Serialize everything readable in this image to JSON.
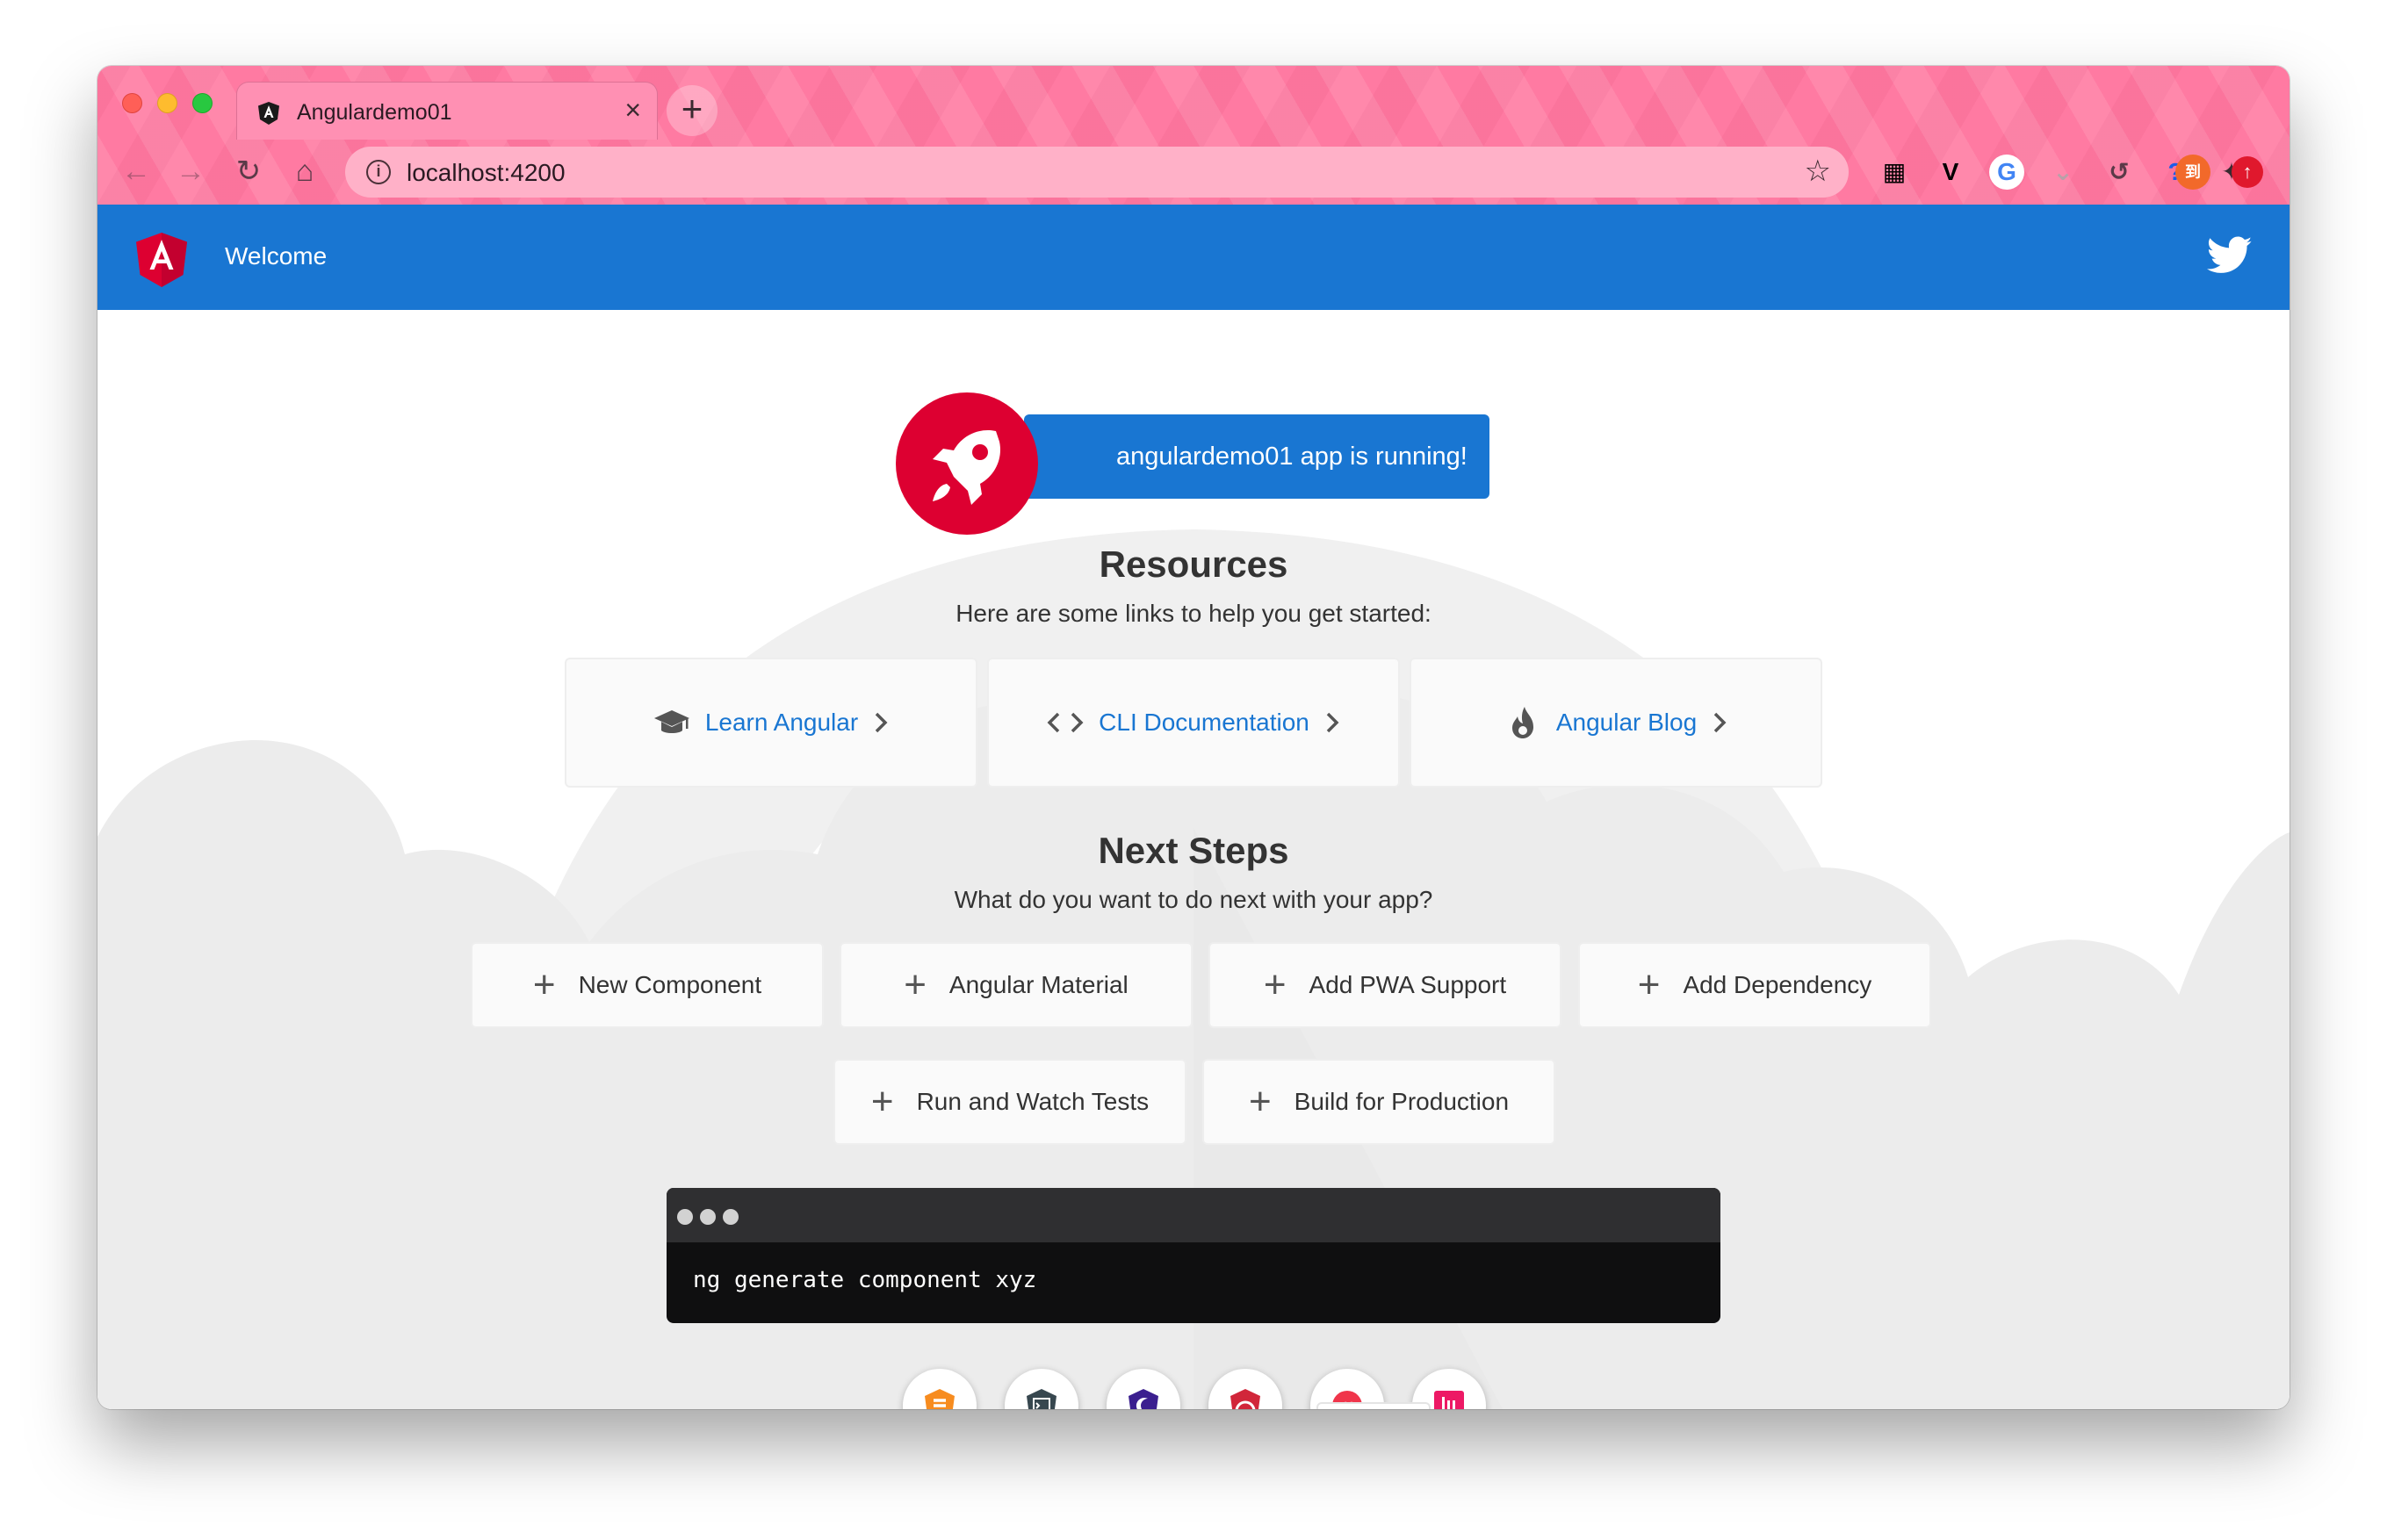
{
  "browser": {
    "tab": {
      "title": "Angulardemo01",
      "close_glyph": "×"
    },
    "new_tab_glyph": "+",
    "nav": {
      "back": "←",
      "forward": "→",
      "reload": "↻",
      "home": "⌂"
    },
    "url": "localhost:4200",
    "info_glyph": "i",
    "star_glyph": "☆",
    "extensions": [
      {
        "name": "qr-code-extension-icon",
        "glyph": "▦",
        "color": "#2a1a22"
      },
      {
        "name": "vimeo-extension-icon",
        "glyph": "V",
        "color": "#1a1a1a"
      },
      {
        "name": "google-translate-extension-icon",
        "glyph": "G",
        "color": "#4285f4"
      },
      {
        "name": "pocket-extension-icon",
        "glyph": "⌄",
        "color": "#b0b0b0"
      },
      {
        "name": "history-extension-icon",
        "glyph": "↺",
        "color": "#5b3a48"
      },
      {
        "name": "help-extension-icon",
        "glyph": "?",
        "color": "#1a5de8"
      },
      {
        "name": "puzzle-extensions-icon",
        "glyph": "✦",
        "color": "#3a2a30"
      },
      {
        "name": "orange-extension-icon",
        "glyph": "到",
        "color": "#ffffff"
      },
      {
        "name": "upload-extension-icon",
        "glyph": "↑",
        "color": "#ffffff"
      }
    ]
  },
  "toolbar": {
    "title": "Welcome"
  },
  "hero": {
    "running_text": "angulardemo01 app is running!"
  },
  "resources": {
    "title": "Resources",
    "subtitle": "Here are some links to help you get started:",
    "items": [
      {
        "label": "Learn Angular",
        "icon": "graduation-cap-icon"
      },
      {
        "label": "CLI Documentation",
        "icon": "code-brackets-icon"
      },
      {
        "label": "Angular Blog",
        "icon": "flame-icon"
      }
    ]
  },
  "next_steps": {
    "title": "Next Steps",
    "subtitle": "What do you want to do next with your app?",
    "items": [
      {
        "label": "New Component"
      },
      {
        "label": "Angular Material"
      },
      {
        "label": "Add PWA Support"
      },
      {
        "label": "Add Dependency"
      },
      {
        "label": "Run and Watch Tests"
      },
      {
        "label": "Build for Production"
      }
    ]
  },
  "terminal": {
    "command": "ng generate component xyz"
  },
  "colors": {
    "brand_blue": "#1976d2",
    "angular_red": "#dd0031",
    "chrome_pink": "#ff7aa2"
  }
}
